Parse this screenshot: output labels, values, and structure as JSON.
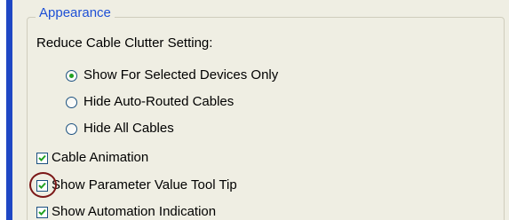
{
  "appearance": {
    "group_title": "Appearance",
    "reduce_label": "Reduce Cable Clutter Setting:",
    "radio_options": [
      {
        "label": "Show For Selected Devices Only",
        "selected": true
      },
      {
        "label": "Hide Auto-Routed Cables",
        "selected": false
      },
      {
        "label": "Hide All Cables",
        "selected": false
      }
    ],
    "checkboxes": [
      {
        "label": "Cable Animation",
        "checked": true
      },
      {
        "label": "Show Parameter Value Tool Tip",
        "checked": true
      },
      {
        "label": "Show Automation Indication",
        "checked": true
      }
    ]
  },
  "colors": {
    "title_blue": "#1e50d6",
    "check_green": "#21a121",
    "annotation_circle": "#7b1717",
    "side_bar_blue": "#1f47c4"
  }
}
